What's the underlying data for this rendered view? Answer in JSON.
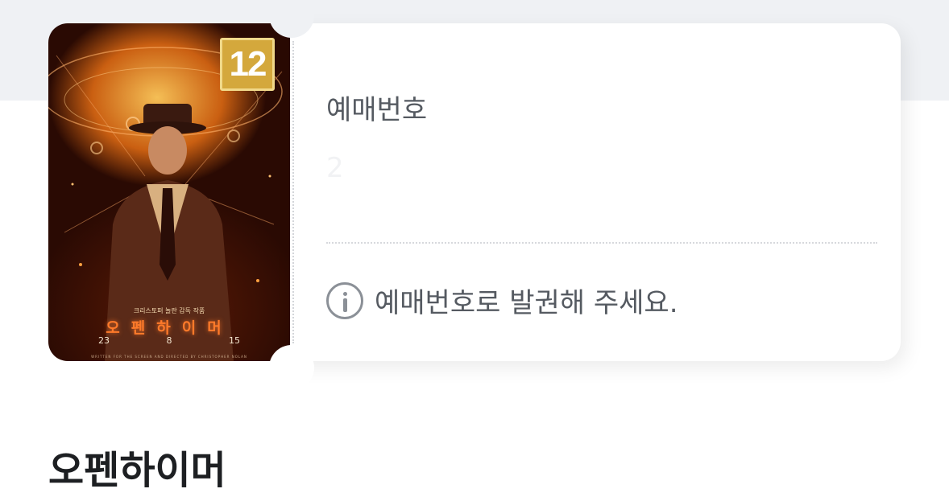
{
  "poster": {
    "age_rating": "12",
    "credit": "크리스토퍼 놀란 감독 작품",
    "title": "오펜하이머",
    "date": [
      "23",
      "8",
      "15"
    ],
    "bottom_text": "WRITTEN FOR THE SCREEN AND DIRECTED BY CHRISTOPHER NOLAN"
  },
  "ticket": {
    "label": "예매번호",
    "value": "2",
    "notice": "예매번호로 발권해 주세요."
  },
  "movie": {
    "title": "오펜하이머"
  },
  "colors": {
    "background_band": "#eff1f4",
    "label_text": "#555a61",
    "title_text": "#1d1f22",
    "badge": "#d4a83c"
  },
  "icons": {
    "notice_icon": "info-icon"
  }
}
